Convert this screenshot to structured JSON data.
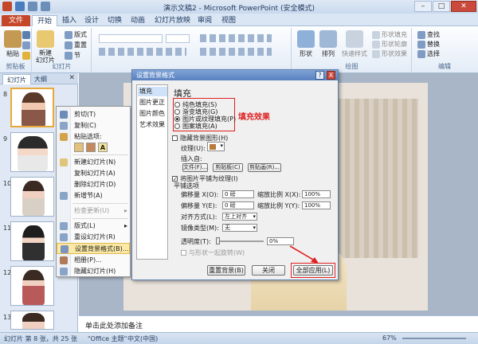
{
  "window": {
    "title": "演示文稿2 - Microsoft PowerPoint (安全模式)"
  },
  "ribbon_tabs": [
    "文件",
    "开始",
    "插入",
    "设计",
    "切换",
    "动画",
    "幻灯片放映",
    "审阅",
    "视图"
  ],
  "ribbon": {
    "clipboard": {
      "paste": "粘贴",
      "label": "剪贴板"
    },
    "slides": {
      "new_slide": "新建\n幻灯片",
      "layout": "版式",
      "reset": "重置",
      "section": "节",
      "label": "幻灯片"
    },
    "drawing": {
      "shape": "形状",
      "arrange": "排列",
      "quick_styles": "快速样式",
      "fill": "形状填充",
      "outline": "形状轮廓",
      "effects": "形状效果",
      "label": "绘图"
    },
    "editing": {
      "find": "查找",
      "replace": "替换",
      "select": "选择",
      "label": "编辑"
    }
  },
  "left_pane": {
    "tabs": [
      "幻灯片",
      "大纲"
    ],
    "slide_numbers": [
      "8",
      "9",
      "10",
      "11",
      "12",
      "13"
    ]
  },
  "context_menu": {
    "items": [
      {
        "label": "剪切(T)",
        "disabled": false
      },
      {
        "label": "复制(C)",
        "disabled": false
      },
      {
        "label": "粘贴选项:",
        "disabled": false
      },
      {
        "label": "新建幻灯片(N)",
        "disabled": false
      },
      {
        "label": "复制幻灯片(A)",
        "disabled": false
      },
      {
        "label": "删除幻灯片(D)",
        "disabled": false
      },
      {
        "label": "新增节(A)",
        "disabled": false
      },
      {
        "label": "检查更新(U)",
        "disabled": true
      },
      {
        "label": "版式(L)",
        "disabled": false
      },
      {
        "label": "重设幻灯片(R)",
        "disabled": false
      },
      {
        "label": "设置背景格式(B)...",
        "disabled": false,
        "highlighted": true
      },
      {
        "label": "相册(P)...",
        "disabled": false
      },
      {
        "label": "隐藏幻灯片(H)",
        "disabled": false
      }
    ]
  },
  "dialog": {
    "title": "设置背景格式",
    "help": "?",
    "close": "X",
    "nav": [
      "填充",
      "图片更正",
      "图片颜色",
      "艺术效果"
    ],
    "heading": "填充",
    "fill_options": [
      "纯色填充(S)",
      "渐变填充(G)",
      "图片或纹理填充(P)",
      "图案填充(A)"
    ],
    "selected_fill": 2,
    "annotation": "填充效果",
    "hide_bg": "隐藏背景图形(H)",
    "texture_label": "纹理(U):",
    "insert_from": "插入自:",
    "btn_file": "文件(F)...",
    "btn_clipboard": "剪贴板(C)",
    "btn_clipart": "剪贴画(R)...",
    "tile_checkbox": "将图片平铺为纹理(I)",
    "tile_options": "平铺选项",
    "offset_x_label": "偏移量 X(O):",
    "offset_x": "0 磅",
    "scale_x_label": "缩放比例 X(X):",
    "scale_x": "100%",
    "offset_y_label": "偏移量 Y(E):",
    "offset_y": "0 磅",
    "scale_y_label": "缩放比例 Y(Y):",
    "scale_y": "100%",
    "align_label": "对齐方式(L):",
    "align_value": "左上对齐",
    "mirror_label": "镜像类型(M):",
    "mirror_value": "无",
    "transparency_label": "透明度(T):",
    "transparency_value": "0%",
    "rotate_label": "与形状一起旋转(W)",
    "btn_reset": "重置背景(B)",
    "btn_close": "关闭",
    "btn_apply_all": "全部应用(L)"
  },
  "notes": "单击此处添加备注",
  "status": {
    "slide_info": "幻灯片 第 8 张，共 25 张",
    "theme": "\"Office 主题\"",
    "lang": "中文(中国)",
    "zoom": "67%"
  },
  "colors": {
    "accent_red": "#e02020",
    "file_tab": "#c5472a",
    "ribbon_blue": "#dbe6f4",
    "menu_highlight": "#fde9a6"
  }
}
